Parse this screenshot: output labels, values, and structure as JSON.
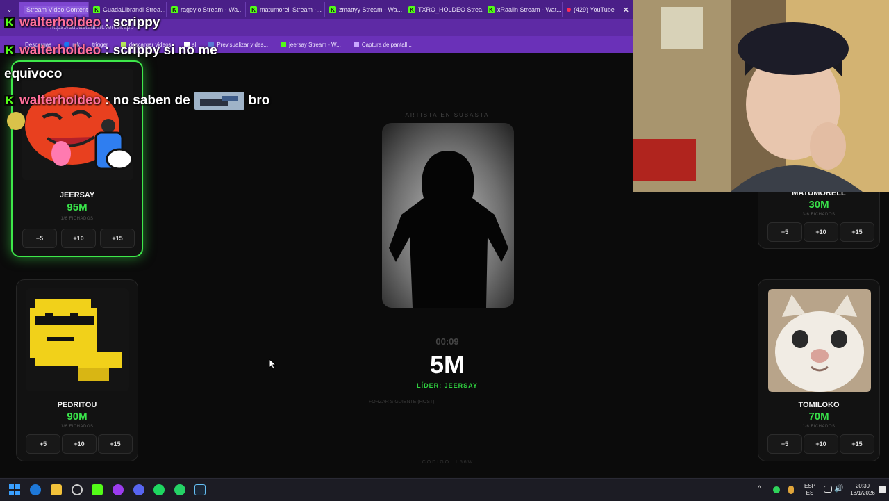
{
  "browser": {
    "tabs": [
      {
        "label": "Stream Video Content",
        "active": true
      },
      {
        "label": "GuadaLibrandi Strea..."
      },
      {
        "label": "rageylo Stream - Wa..."
      },
      {
        "label": "matumorell Stream -..."
      },
      {
        "label": "zmattyy Stream - Wa..."
      },
      {
        "label": "TXRO_HOLDEO Strea..."
      },
      {
        "label": "xRaaiin Stream - Wat..."
      },
      {
        "label": "(429) YouTube"
      }
    ],
    "address": "https://subastadraft.vercel.app",
    "bookmarks": [
      "Descargas",
      "mk",
      "trigger",
      "descargar videos",
      "sl",
      "Previsualizar y des...",
      "jeersay Stream - W...",
      "Captura de pantall..."
    ]
  },
  "chat": {
    "messages": [
      {
        "user": "walterholdeo",
        "text": ": scrippy"
      },
      {
        "user": "walterholdeo",
        "text": ": scrippy si no me"
      },
      {
        "user": "walterholdeo",
        "text": ": no saben de",
        "suffix": "bro"
      }
    ],
    "continuation": "equivoco"
  },
  "auction": {
    "label": "ARTISTA EN SUBASTA",
    "timer": "00:09",
    "price": "5M",
    "leader": "LÍDER: JEERSAY",
    "force_next": "FORZAR SIGUIENTE (HOST)",
    "code": "CÓDIGO: L56W"
  },
  "players": [
    {
      "name": "JEERSAY",
      "money": "95M",
      "fichados": "1/6 FICHADOS",
      "bids": [
        "+5",
        "+10",
        "+15"
      ]
    },
    {
      "name": "PEDRITOU",
      "money": "90M",
      "fichados": "1/6 FICHADOS",
      "bids": [
        "+5",
        "+10",
        "+15"
      ]
    },
    {
      "name": "MATUMORELL",
      "money": "30M",
      "fichados": "3/6 FICHADOS",
      "bids": [
        "+5",
        "+10",
        "+15"
      ]
    },
    {
      "name": "TOMILOKO",
      "money": "70M",
      "fichados": "1/6 FICHADOS",
      "bids": [
        "+5",
        "+10",
        "+15"
      ]
    }
  ],
  "taskbar": {
    "lang": "ESP",
    "lang2": "ES",
    "time": "20:30",
    "date": "18/1/2026"
  },
  "colors": {
    "accent_green": "#39e34a",
    "browser_purple": "#5e2aa5",
    "chat_user": "#ff6f9a"
  }
}
